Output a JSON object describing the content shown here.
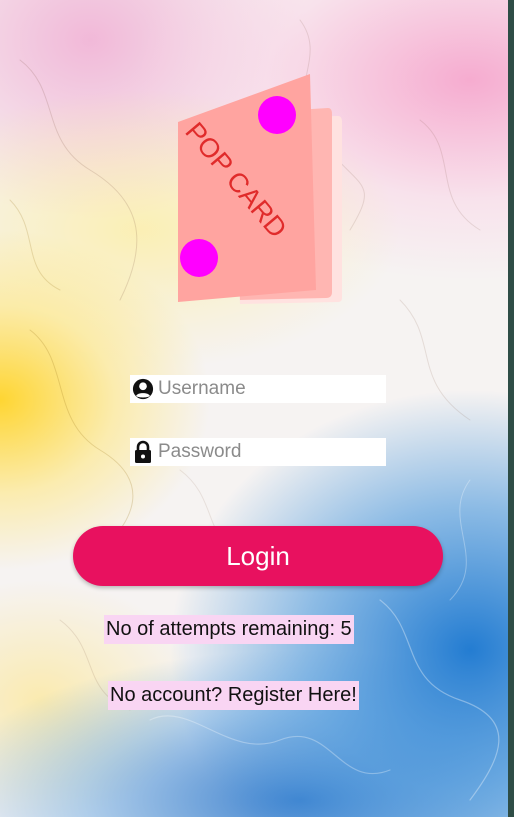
{
  "logo": {
    "text": "POP CARD",
    "card_color": "#ffa4a0",
    "dot_color": "#ff00ff",
    "text_color": "#e02b2b"
  },
  "form": {
    "username_placeholder": "Username",
    "password_placeholder": "Password",
    "username_icon": "user-circle-icon",
    "password_icon": "lock-icon"
  },
  "login_button": {
    "label": "Login",
    "color": "#e8115f"
  },
  "attempts_text": "No of attempts remaining: 5",
  "register_link": "No account? Register Here!"
}
